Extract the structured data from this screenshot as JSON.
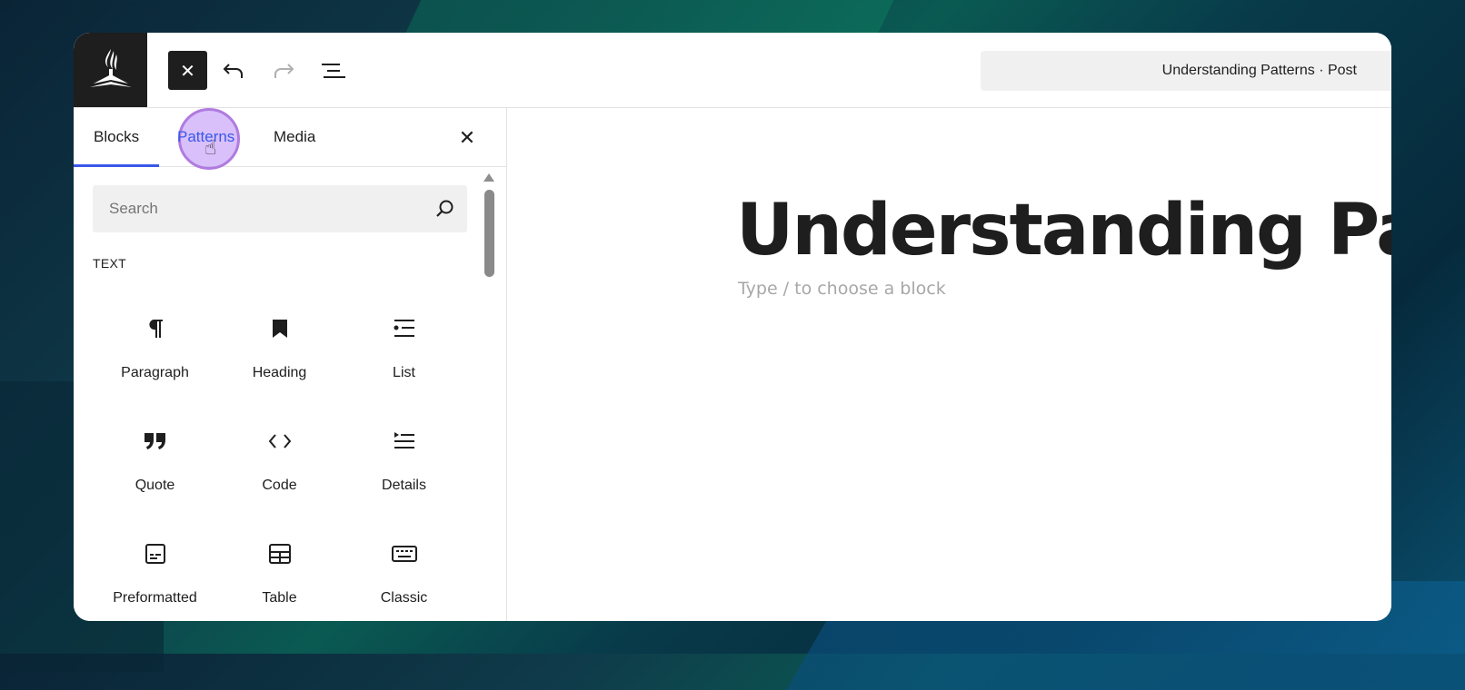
{
  "toolbar": {
    "close_label": "✕",
    "document_title": "Understanding Patterns · Post"
  },
  "sidebar": {
    "tabs": [
      {
        "label": "Blocks",
        "active": true
      },
      {
        "label": "Patterns",
        "active": false
      },
      {
        "label": "Media",
        "active": false
      }
    ],
    "close_label": "✕",
    "search": {
      "placeholder": "Search",
      "value": ""
    },
    "section_label": "TEXT",
    "blocks": [
      {
        "label": "Paragraph",
        "icon": "paragraph-icon"
      },
      {
        "label": "Heading",
        "icon": "heading-icon"
      },
      {
        "label": "List",
        "icon": "list-icon"
      },
      {
        "label": "Quote",
        "icon": "quote-icon"
      },
      {
        "label": "Code",
        "icon": "code-icon"
      },
      {
        "label": "Details",
        "icon": "details-icon"
      },
      {
        "label": "Preformatted",
        "icon": "preformatted-icon"
      },
      {
        "label": "Table",
        "icon": "table-icon"
      },
      {
        "label": "Classic",
        "icon": "classic-icon"
      }
    ]
  },
  "editor": {
    "post_title": "Understanding Pat",
    "block_placeholder": "Type / to choose a block"
  },
  "colors": {
    "accent": "#3858e9",
    "toolbar_dark": "#1e1e1e",
    "cursor_highlight": "#b07be0"
  }
}
